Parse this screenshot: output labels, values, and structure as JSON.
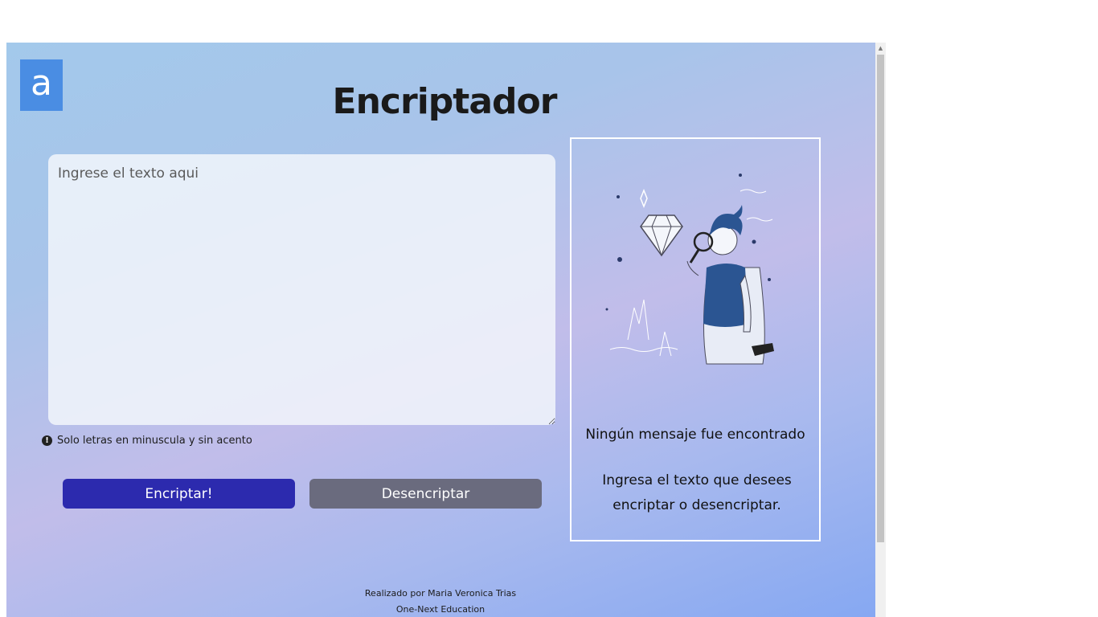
{
  "logo": {
    "letter": "a"
  },
  "header": {
    "title": "Encriptador"
  },
  "input": {
    "placeholder": "Ingrese el texto aqui"
  },
  "hint": {
    "icon": "exclamation-icon",
    "text": "Solo letras en minuscula y sin acento"
  },
  "buttons": {
    "encrypt": "Encriptar!",
    "decrypt": "Desencriptar"
  },
  "output": {
    "title": "Ningún mensaje fue encontrado",
    "body": "Ingresa el texto que desees encriptar o desencriptar."
  },
  "footer": {
    "line1": "Realizado por Maria Veronica Trias",
    "line2": "One-Next Education"
  },
  "colors": {
    "encrypt_button": "#2c2aae",
    "decrypt_button": "#6a6b7e",
    "logo": "#4a8de3",
    "illustration_accent": "#2b5592"
  }
}
